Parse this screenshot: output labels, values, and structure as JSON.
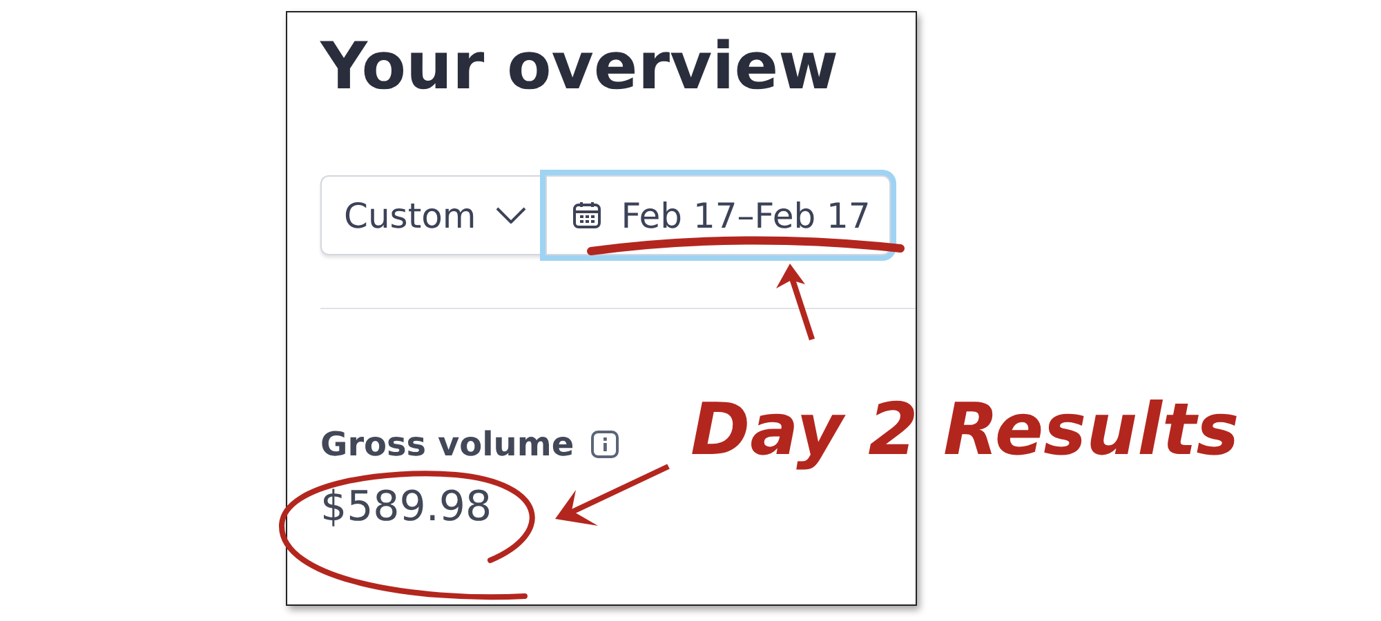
{
  "title": "Your overview",
  "period_select": {
    "value": "Custom"
  },
  "date_range": {
    "label": "Feb 17–Feb 17",
    "focused": true
  },
  "metric": {
    "label": "Gross volume",
    "value": "$589.98"
  },
  "annotation": {
    "text": "Day 2 Results"
  }
}
